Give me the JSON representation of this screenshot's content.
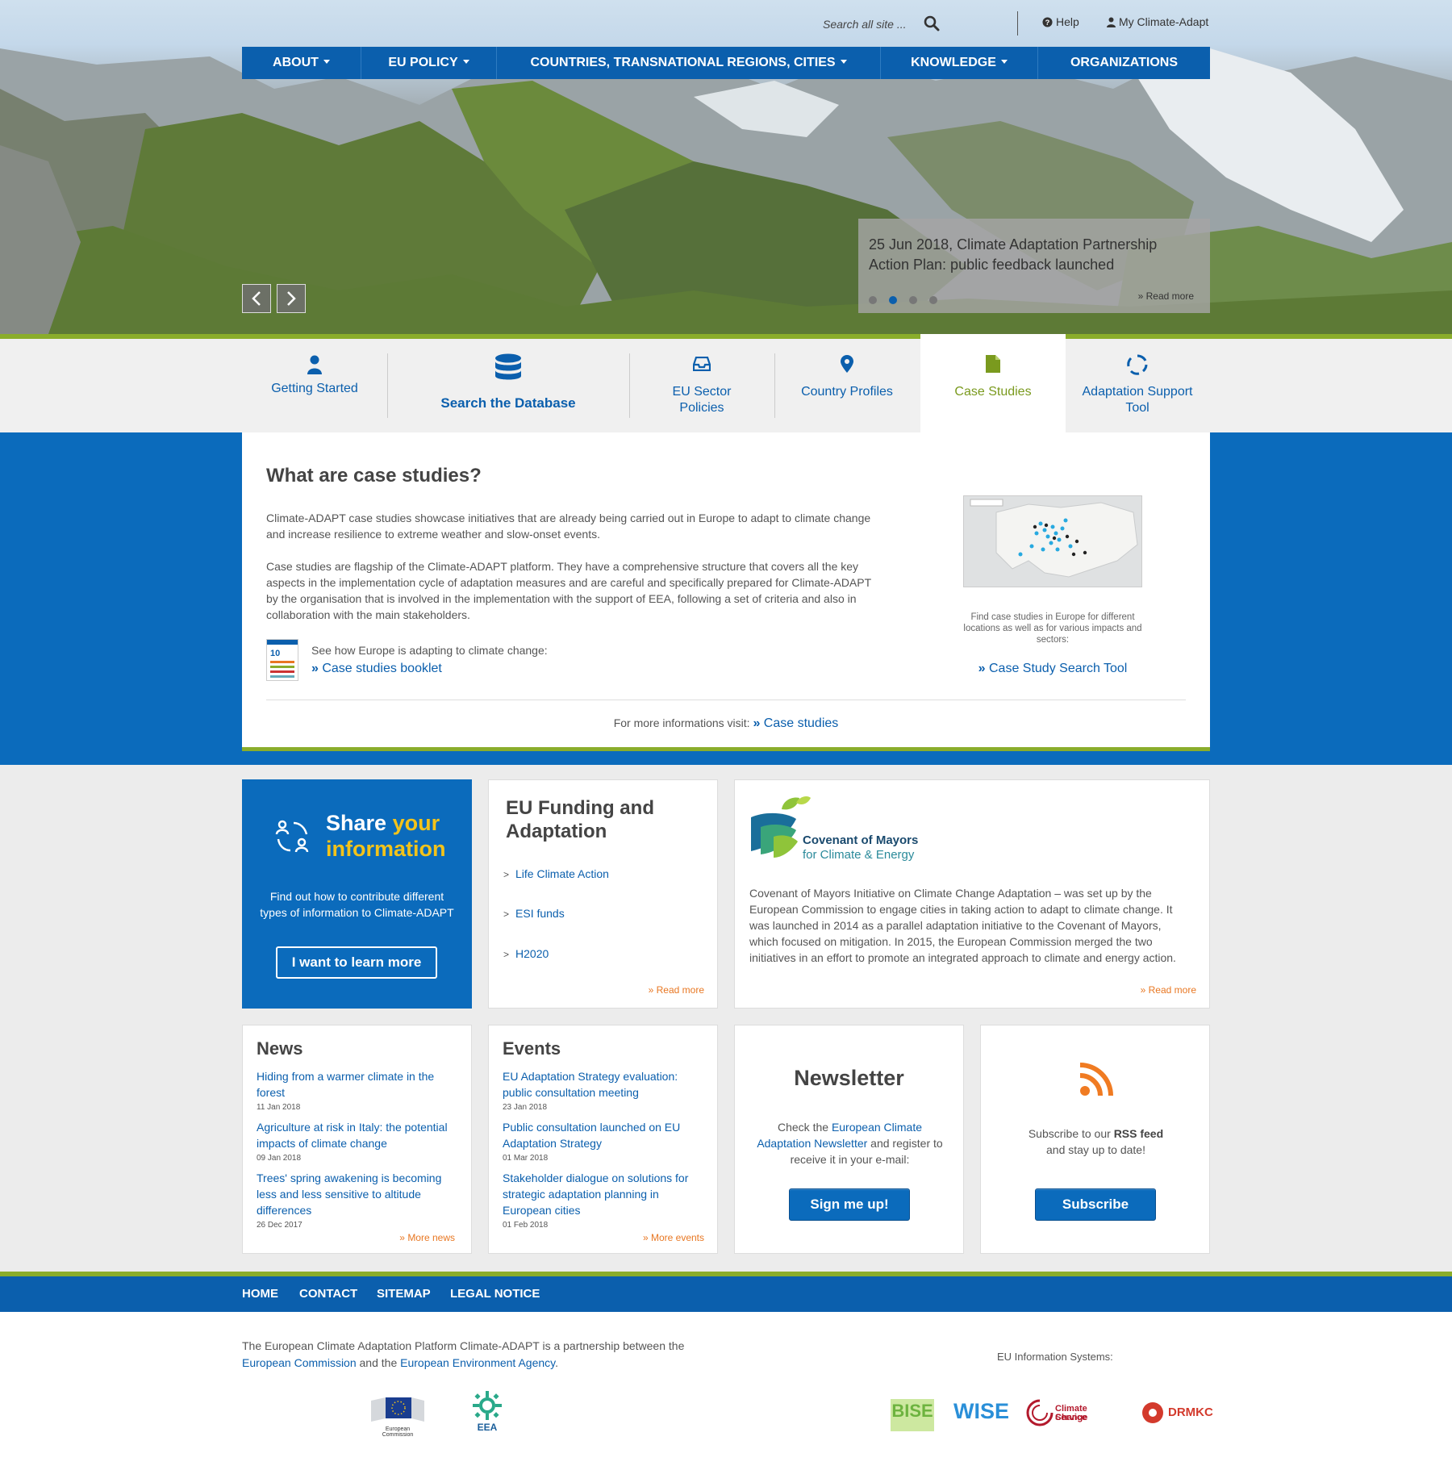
{
  "topbar": {
    "search_placeholder": "Search all site ...",
    "help": "Help",
    "my_account": "My Climate-Adapt"
  },
  "nav": [
    {
      "label": "About",
      "dropdown": true
    },
    {
      "label": "EU Policy",
      "dropdown": true
    },
    {
      "label": "Countries, transnational regions, cities",
      "dropdown": true
    },
    {
      "label": "Knowledge",
      "dropdown": true
    },
    {
      "label": "Organizations",
      "dropdown": false
    }
  ],
  "slider": {
    "title": "25 Jun 2018, Climate Adaptation Partnership Action Plan: public feedback launched",
    "read_more": "Read more",
    "dots": 4,
    "active_dot": 2
  },
  "tabs": [
    {
      "label": "Getting Started",
      "icon": "user-icon"
    },
    {
      "label": "Search the Database",
      "icon": "database-icon"
    },
    {
      "label": "EU Sector Policies",
      "icon": "inbox-icon"
    },
    {
      "label": "Country Profiles",
      "icon": "map-marker-icon"
    },
    {
      "label": "Case Studies",
      "icon": "file-icon",
      "active": true
    },
    {
      "label": "Adaptation Support Tool",
      "icon": "cycle-icon"
    }
  ],
  "case_studies": {
    "heading": "What are case studies?",
    "p1": "Climate-ADAPT case studies showcase initiatives that are already being carried out in Europe to adapt to climate change and increase resilience to extreme weather and slow-onset events.",
    "p2": "Case studies are flagship of the Climate-ADAPT platform. They have a comprehensive structure that covers all the key aspects in the implementation cycle of adaptation measures and are careful and specifically prepared for Climate-ADAPT by the organisation that is involved in the implementation with the support of EEA, following a set of criteria and also in collaboration with the main stakeholders.",
    "booklet_intro": "See how Europe is adapting to climate change:",
    "booklet_link": "Case studies booklet",
    "map_caption": "Find case studies in Europe for different locations as well as for various impacts and sectors:",
    "map_link": "Case Study Search Tool",
    "more_info_label": "For more informations visit:",
    "more_info_link": "Case studies"
  },
  "share": {
    "title_a": "Share",
    "title_b": "your",
    "title_c": "information",
    "text": "Find out how to contribute different types of information to Climate-ADAPT",
    "button": "I want to learn more"
  },
  "funding": {
    "title": "EU Funding and Adaptation",
    "links": [
      "Life Climate Action",
      "ESI funds",
      "H2020"
    ],
    "read_more": "Read more"
  },
  "covenant": {
    "logo_name": "Covenant of Mayors",
    "logo_sub": "for Climate & Energy",
    "text": "Covenant of Mayors Initiative on Climate Change Adaptation – was set up by the European Commission to engage cities in taking action to adapt to climate change. It was launched in 2014 as a parallel adaptation initiative to the Covenant of Mayors, which focused on mitigation. In 2015, the European Commission merged the two initiatives in an effort to promote an integrated approach to climate and energy action.",
    "read_more": "Read more"
  },
  "news": {
    "title": "News",
    "items": [
      {
        "title": "Hiding from a warmer climate in the forest",
        "date": "11 Jan 2018"
      },
      {
        "title": "Agriculture at risk in Italy: the potential impacts of climate change",
        "date": "09 Jan 2018"
      },
      {
        "title": "Trees' spring awakening is becoming less and less sensitive to altitude differences",
        "date": "26 Dec 2017"
      }
    ],
    "more": "More news"
  },
  "events": {
    "title": "Events",
    "items": [
      {
        "title": "EU Adaptation  Strategy evaluation: public consultation meeting",
        "date": "23 Jan 2018"
      },
      {
        "title": "Public consultation launched on EU Adaptation Strategy",
        "date": "01 Mar 2018"
      },
      {
        "title": "Stakeholder dialogue on solutions for strategic adaptation planning in European cities",
        "date": "01 Feb 2018"
      }
    ],
    "more": "More events"
  },
  "newsletter": {
    "title": "Newsletter",
    "text_pre": "Check the",
    "text_link": "European Climate Adaptation Newsletter",
    "text_post": "and register to receive it in your e-mail:",
    "button": "Sign me up!"
  },
  "rss": {
    "text_pre": "Subscribe to our",
    "text_bold": "RSS feed",
    "text_post": "and stay up to date!",
    "button": "Subscribe"
  },
  "footer_nav": [
    "Home",
    "Contact",
    "Sitemap",
    "Legal notice"
  ],
  "footer": {
    "text_pre": "The European Climate Adaptation Platform Climate-ADAPT is a partnership between the",
    "link_ec": "European Commission",
    "text_mid": "and the",
    "link_eea": "European Environment Agency",
    "text_end": ".",
    "eu_systems": "EU Information Systems:",
    "logos": {
      "ec": "European Commission",
      "eea": "EEA",
      "bise": "BISE",
      "wise": "WISE",
      "ccs_a": "Climate Change",
      "ccs_b": "Service",
      "drmkc": "DRMKC"
    }
  },
  "colors": {
    "primary_blue": "#0b5fad",
    "band_blue": "#0b6bbc",
    "accent_green": "#8aad2b",
    "accent_yellow": "#f3c31a",
    "accent_orange": "#e87722"
  }
}
